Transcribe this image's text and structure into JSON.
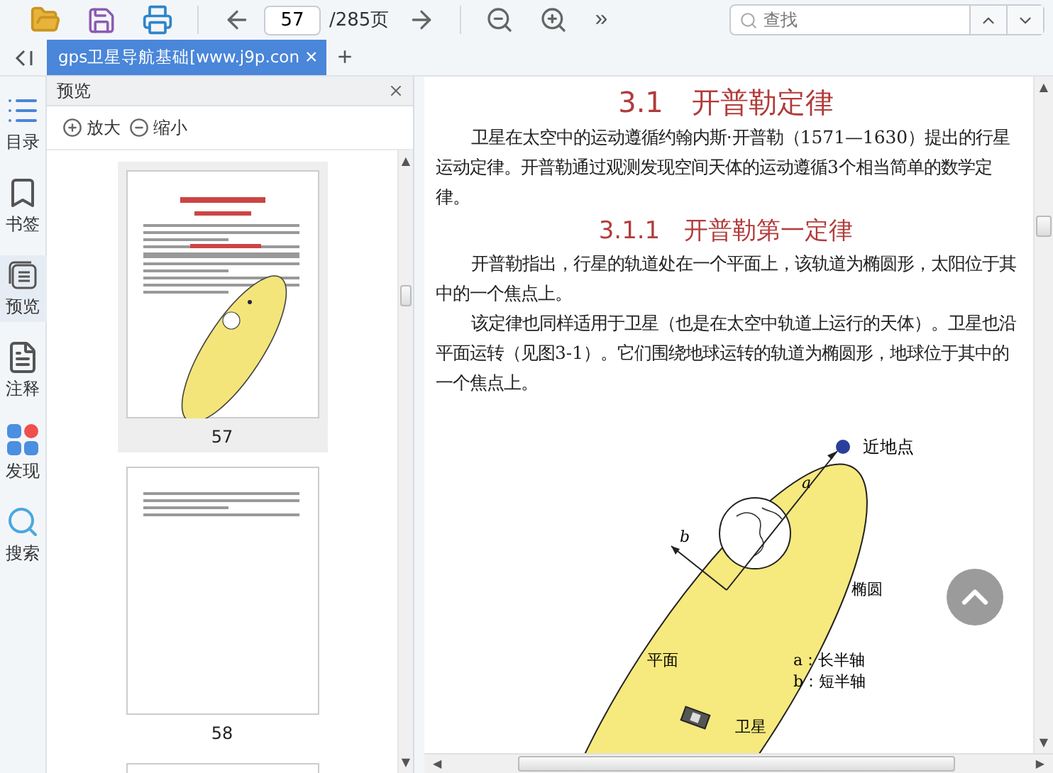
{
  "toolbar": {
    "page_input": "57",
    "page_total": "/285页",
    "more": "»",
    "search": {
      "placeholder": "查找"
    }
  },
  "tabs": [
    {
      "label": "gps卫星导航基础[www.j9p.con",
      "selected": true
    }
  ],
  "tab_close": "×",
  "tab_add": "+",
  "scrollbar_arrows": {
    "up": "▲",
    "down": "▼",
    "left": "◀",
    "right": "▶"
  },
  "sidebar": {
    "items": [
      {
        "label": "目录",
        "kind": "toc",
        "selected": false
      },
      {
        "label": "书签",
        "kind": "bookmark",
        "selected": false
      },
      {
        "label": "预览",
        "kind": "preview",
        "selected": true
      },
      {
        "label": "注释",
        "kind": "notes",
        "selected": false
      },
      {
        "label": "发现",
        "kind": "apps",
        "selected": false
      },
      {
        "label": "搜索",
        "kind": "search",
        "selected": false
      }
    ]
  },
  "preview_panel": {
    "title": "预览",
    "zoom_in": "放大",
    "zoom_out": "缩小",
    "pages": [
      {
        "label": "57",
        "kind": "figure",
        "selected": true
      },
      {
        "label": "58",
        "kind": "text",
        "selected": false
      },
      {
        "kind": "blank",
        "selected": false
      }
    ]
  },
  "document": {
    "heading": "3.1　开普勒定律",
    "paragraphs_1": [
      "卫星在太空中的运动遵循约翰内斯·开普勒（1571—1630）提出的行星运动定律。开普勒通过观测发现空间天体的运动遵循3个相当简单的数学定律。"
    ],
    "subheading": "3.1.1　开普勒第一定律",
    "paragraphs_2": [
      "开普勒指出，行星的轨道处在一个平面上，该轨道为椭圆形，太阳位于其中的一个焦点上。",
      "该定律也同样适用于卫星（也是在太空中轨道上运行的天体）。卫星也沿平面运转（见图3-1）。它们围绕地球运转的轨道为椭圆形，地球位于其中的一个焦点上。"
    ],
    "figure": {
      "perigee": "近地点",
      "a": "a",
      "b": "b",
      "ellipse": "椭圆",
      "plane": "平面",
      "legend_a": "a：长半轴",
      "legend_b": "b：短半轴",
      "satellite": "卫星"
    }
  }
}
